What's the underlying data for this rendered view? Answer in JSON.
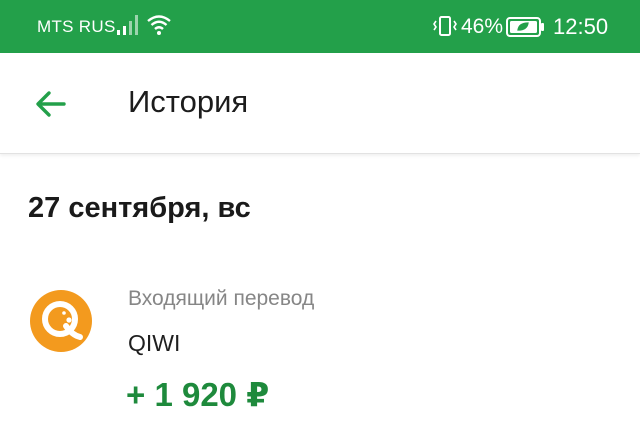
{
  "colors": {
    "status_bar": "#23a04a",
    "accent": "#23a04a",
    "amount_positive": "#1e8a3c",
    "qiwi_orange": "#f39a1e"
  },
  "status_bar": {
    "carrier": "MTS RUS",
    "battery_percent": "46%",
    "time": "12:50",
    "icons": [
      "signal-icon",
      "wifi-icon",
      "vibrate-icon",
      "battery-charging-icon"
    ]
  },
  "app_bar": {
    "back_icon": "arrow-back-icon",
    "title": "История"
  },
  "history": {
    "date_header": "27 сентября, вс",
    "transactions": [
      {
        "type": "Входящий перевод",
        "name": "QIWI",
        "amount": "+ 1 920 ₽",
        "icon": "qiwi-logo-icon"
      }
    ]
  }
}
